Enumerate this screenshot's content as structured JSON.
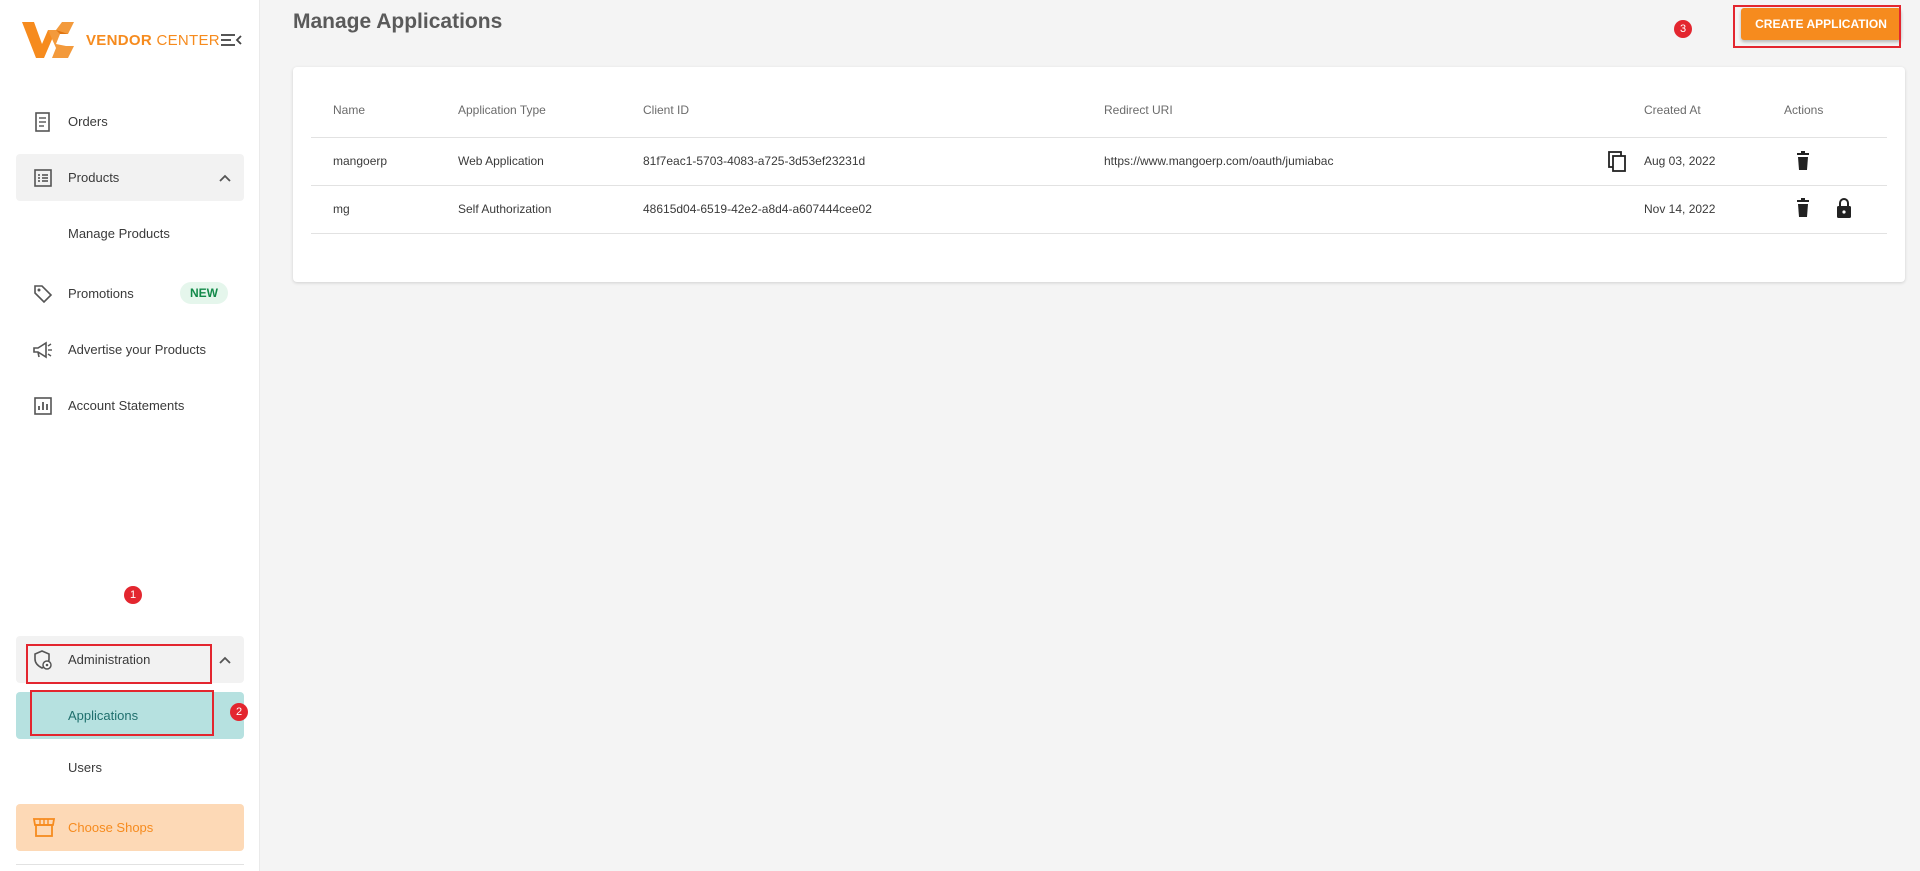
{
  "brand": {
    "name_bold": "VENDOR",
    "name_light": " CENTER",
    "color": "#f68b1e"
  },
  "sidebar": {
    "items": [
      {
        "label": "Orders",
        "icon": "receipt-icon"
      },
      {
        "label": "Products",
        "icon": "list-icon"
      },
      {
        "label": "Manage Products"
      },
      {
        "label": "Promotions",
        "icon": "tag-icon",
        "badge": "NEW"
      },
      {
        "label": "Advertise your Products",
        "icon": "megaphone-icon"
      },
      {
        "label": "Account Statements",
        "icon": "chart-box-icon"
      },
      {
        "label": "Administration",
        "icon": "admin-shield-icon"
      },
      {
        "label": "Applications",
        "active": true
      },
      {
        "label": "Users"
      }
    ],
    "choose_shops": "Choose Shops"
  },
  "annotations": [
    "1",
    "2",
    "3"
  ],
  "page": {
    "title": "Manage Applications",
    "create_button": "CREATE APPLICATION"
  },
  "table": {
    "headers": [
      "Name",
      "Application Type",
      "Client ID",
      "Redirect URI",
      "Created At",
      "Actions"
    ],
    "rows": [
      {
        "name": "mangoerp",
        "type": "Web Application",
        "client_id": "81f7eac1-5703-4083-a725-3d53ef23231d",
        "redirect_uri": "https://www.mangoerp.com/oauth/jumiabac",
        "created_at": "Aug 03, 2022",
        "actions": [
          "copy-icon",
          "trash-icon"
        ]
      },
      {
        "name": "mg",
        "type": "Self Authorization",
        "client_id": "48615d04-6519-42e2-a8d4-a607444cee02",
        "redirect_uri": "",
        "created_at": "Nov 14, 2022",
        "actions": [
          "trash-icon",
          "lock-icon"
        ]
      }
    ]
  },
  "colors": {
    "accent": "#f68b1e",
    "active_bg": "#b6e1e0",
    "annotation": "#e3262f",
    "badge_bg": "#e5f6ec",
    "badge_text": "#138a4a"
  }
}
